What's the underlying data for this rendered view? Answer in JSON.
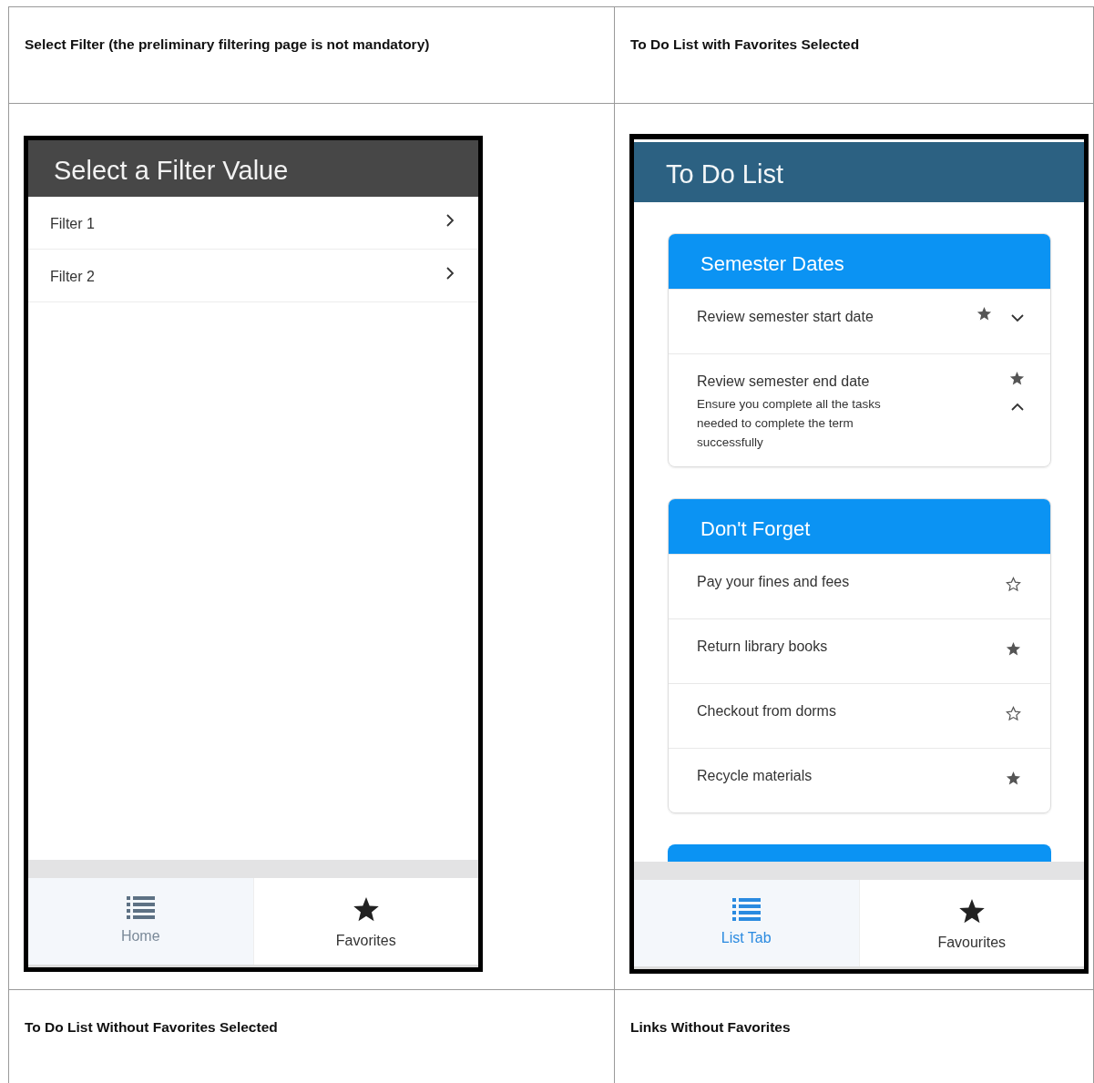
{
  "table": {
    "rows": [
      {
        "kind": "captions",
        "cells": [
          "Select Filter (the preliminary filtering page is not mandatory)",
          "To Do List with Favorites Selected"
        ]
      },
      {
        "kind": "screens"
      },
      {
        "kind": "captions",
        "cells": [
          "To Do List Without Favorites Selected",
          "Links Without Favorites"
        ]
      }
    ]
  },
  "screens": [
    {
      "kind": "filter",
      "title": "Select a Filter Value",
      "items": [
        {
          "label": "Filter 1"
        },
        {
          "label": "Filter 2"
        }
      ],
      "tabs": [
        {
          "kind": "list",
          "label": "Home",
          "selected": true
        },
        {
          "kind": "star",
          "label": "Favorites",
          "selected": false
        }
      ]
    },
    {
      "kind": "todo",
      "title": "To Do List",
      "groups": [
        {
          "kind": "card",
          "title": "Semester Dates",
          "items": [
            {
              "text": "Review semester start date",
              "favorite": true,
              "expanded": false
            },
            {
              "text": "Review semester end date",
              "detail": "Ensure you complete all the tasks needed to complete the term successfully",
              "favorite": true,
              "expanded": true
            }
          ]
        },
        {
          "kind": "card",
          "title": "Don't Forget",
          "items": [
            {
              "text": "Pay your fines and fees",
              "favorite": false
            },
            {
              "text": "Return library books",
              "favorite": true
            },
            {
              "text": "Checkout from dorms",
              "favorite": false
            },
            {
              "text": "Recycle materials",
              "favorite": true
            }
          ]
        },
        {
          "kind": "cut"
        }
      ],
      "tabs": [
        {
          "kind": "list",
          "label": "List Tab",
          "selected": true
        },
        {
          "kind": "star",
          "label": "Favourites",
          "selected": false
        }
      ]
    }
  ]
}
